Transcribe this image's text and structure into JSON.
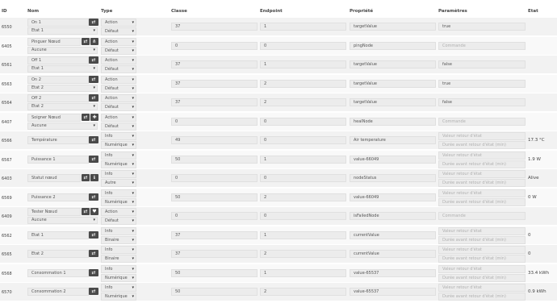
{
  "headers": {
    "id": "ID",
    "nom": "Nom",
    "type": "Type",
    "classe": "Classe",
    "endpoint": "Endpoint",
    "propriete": "Propriété",
    "parametres": "Paramètres",
    "etat": "Etat"
  },
  "placeholders": {
    "commande": "Commande",
    "valeur_retour": "Valeur retour d'état",
    "duree_avant": "Durée avant retour d'état (min)"
  },
  "rows": [
    {
      "id": "6550",
      "name": "On 1",
      "sub": "Etat 1",
      "icon": "switch-icon",
      "type1": "Action",
      "type2": "Défaut",
      "classe": "37",
      "endpoint": "1",
      "prop": "targetValue",
      "param": "true",
      "etat": ""
    },
    {
      "id": "6405",
      "name": "Pinguer Nœud",
      "sub": "Aucune",
      "icon": "network-icon",
      "type1": "Action",
      "type2": "Défaut",
      "classe": "0",
      "endpoint": "0",
      "prop": "pingNode",
      "param": "",
      "etat": ""
    },
    {
      "id": "6561",
      "name": "Off 1",
      "sub": "Etat 1",
      "icon": "switch-icon",
      "type1": "Action",
      "type2": "Défaut",
      "classe": "37",
      "endpoint": "1",
      "prop": "targetValue",
      "param": "false",
      "etat": ""
    },
    {
      "id": "6563",
      "name": "On 2",
      "sub": "Etat 2",
      "icon": "switch-icon",
      "type1": "Action",
      "type2": "Défaut",
      "classe": "37",
      "endpoint": "2",
      "prop": "targetValue",
      "param": "true",
      "etat": ""
    },
    {
      "id": "6564",
      "name": "Off 2",
      "sub": "Etat 2",
      "icon": "switch-icon",
      "type1": "Action",
      "type2": "Défaut",
      "classe": "37",
      "endpoint": "2",
      "prop": "targetValue",
      "param": "false",
      "etat": ""
    },
    {
      "id": "6407",
      "name": "Soigner Nœud",
      "sub": "Aucune",
      "icon": "first-aid-icon",
      "type1": "Action",
      "type2": "Défaut",
      "classe": "0",
      "endpoint": "0",
      "prop": "healNode",
      "param": "",
      "etat": ""
    },
    {
      "id": "6566",
      "name": "Température",
      "sub": "",
      "icon": "switch-icon",
      "type1": "Info",
      "type2": "Numérique",
      "classe": "49",
      "endpoint": "0",
      "prop": "Air temperature",
      "param": "",
      "etat": "17.3 °C"
    },
    {
      "id": "6567",
      "name": "Puissance 1",
      "sub": "",
      "icon": "switch-icon",
      "type1": "Info",
      "type2": "Numérique",
      "classe": "50",
      "endpoint": "1",
      "prop": "value-66049",
      "param": "",
      "etat": "1.9 W"
    },
    {
      "id": "6403",
      "name": "Statut nœud",
      "sub": "",
      "icon": "info-icon",
      "type1": "Info",
      "type2": "Autre",
      "classe": "0",
      "endpoint": "0",
      "prop": "nodeStatus",
      "param": "",
      "etat": "Alive"
    },
    {
      "id": "6569",
      "name": "Puissance 2",
      "sub": "",
      "icon": "switch-icon",
      "type1": "Info",
      "type2": "Numérique",
      "classe": "50",
      "endpoint": "2",
      "prop": "value-66049",
      "param": "",
      "etat": "0 W"
    },
    {
      "id": "6409",
      "name": "Tester Nœud",
      "sub": "Aucune",
      "icon": "heartbeat-icon",
      "type1": "Action",
      "type2": "Défaut",
      "classe": "0",
      "endpoint": "0",
      "prop": "isFailedNode",
      "param": "",
      "etat": ""
    },
    {
      "id": "6562",
      "name": "Etat 1",
      "sub": "",
      "icon": "switch-icon",
      "type1": "Info",
      "type2": "Binaire",
      "classe": "37",
      "endpoint": "1",
      "prop": "currentValue",
      "param": "",
      "etat": "0"
    },
    {
      "id": "6565",
      "name": "Etat 2",
      "sub": "",
      "icon": "switch-icon",
      "type1": "Info",
      "type2": "Binaire",
      "classe": "37",
      "endpoint": "2",
      "prop": "currentValue",
      "param": "",
      "etat": "0"
    },
    {
      "id": "6568",
      "name": "Consommation 1",
      "sub": "",
      "icon": "switch-icon",
      "type1": "Info",
      "type2": "Numérique",
      "classe": "50",
      "endpoint": "1",
      "prop": "value-65537",
      "param": "",
      "etat": "33.4 kWh"
    },
    {
      "id": "6570",
      "name": "Consommation 2",
      "sub": "",
      "icon": "switch-icon",
      "type1": "Info",
      "type2": "Numérique",
      "classe": "50",
      "endpoint": "2",
      "prop": "value-65537",
      "param": "",
      "etat": "0.9 kWh"
    }
  ]
}
